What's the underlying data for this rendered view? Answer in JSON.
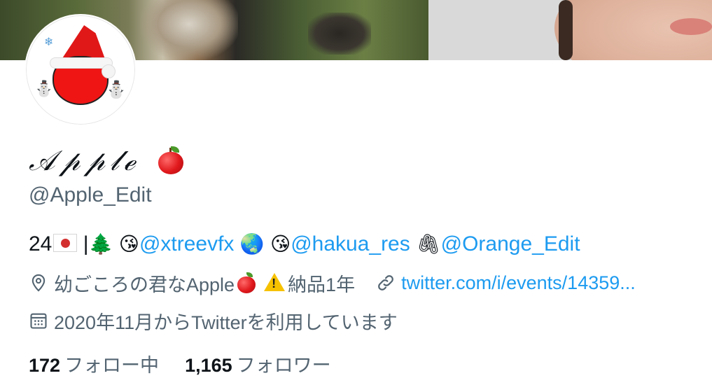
{
  "profile": {
    "display_name": "𝒜𝓅𝓅𝓁ℯ",
    "handle": "@Apple_Edit"
  },
  "bio": {
    "age": "24",
    "separator": " |",
    "mention_1": "@xtreevfx",
    "mention_2": "@hakua_res",
    "mention_3": "@Orange_Edit",
    "emoji_tree": "🌲",
    "emoji_kiss_1": "😘",
    "emoji_globe": "🌏",
    "emoji_kiss_2": "😘",
    "emoji_clip": "🖇"
  },
  "meta": {
    "location": "幼ごころの君なApple",
    "note": "納品1年",
    "url": "twitter.com/i/events/14359..."
  },
  "joined": {
    "text": "2020年11月からTwitterを利用しています"
  },
  "stats": {
    "following_count": "172",
    "following_label": "フォロー中",
    "followers_count": "1,165",
    "followers_label": "フォロワー"
  },
  "icons": {
    "location": "location-pin-icon",
    "link": "link-icon",
    "calendar": "calendar-icon",
    "warning": "warning-icon",
    "apple": "red-apple-icon",
    "flag": "japan-flag-icon"
  },
  "colors": {
    "link": "#1d9bf0",
    "secondary_text": "#536471",
    "primary_text": "#0f1419"
  }
}
